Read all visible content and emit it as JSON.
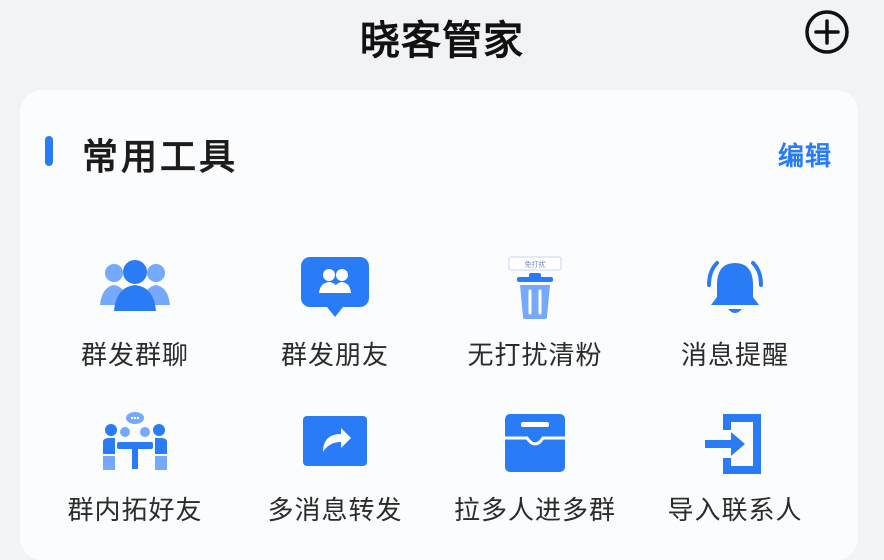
{
  "header": {
    "title": "晓客管家",
    "add_icon": "plus-circle-icon"
  },
  "tools_section": {
    "title": "常用工具",
    "edit_label": "编辑",
    "accent_color": "#2a7bf6",
    "items": [
      {
        "label": "群发群聊",
        "icon": "group-users-icon"
      },
      {
        "label": "群发朋友",
        "icon": "friends-message-icon"
      },
      {
        "label": "无打扰清粉",
        "icon": "trash-icon",
        "icon_badge": "免打扰"
      },
      {
        "label": "消息提醒",
        "icon": "bell-icon"
      },
      {
        "label": "群内拓好友",
        "icon": "meeting-table-icon"
      },
      {
        "label": "多消息转发",
        "icon": "share-forward-icon"
      },
      {
        "label": "拉多人进多群",
        "icon": "inbox-icon"
      },
      {
        "label": "导入联系人",
        "icon": "import-icon"
      }
    ]
  }
}
